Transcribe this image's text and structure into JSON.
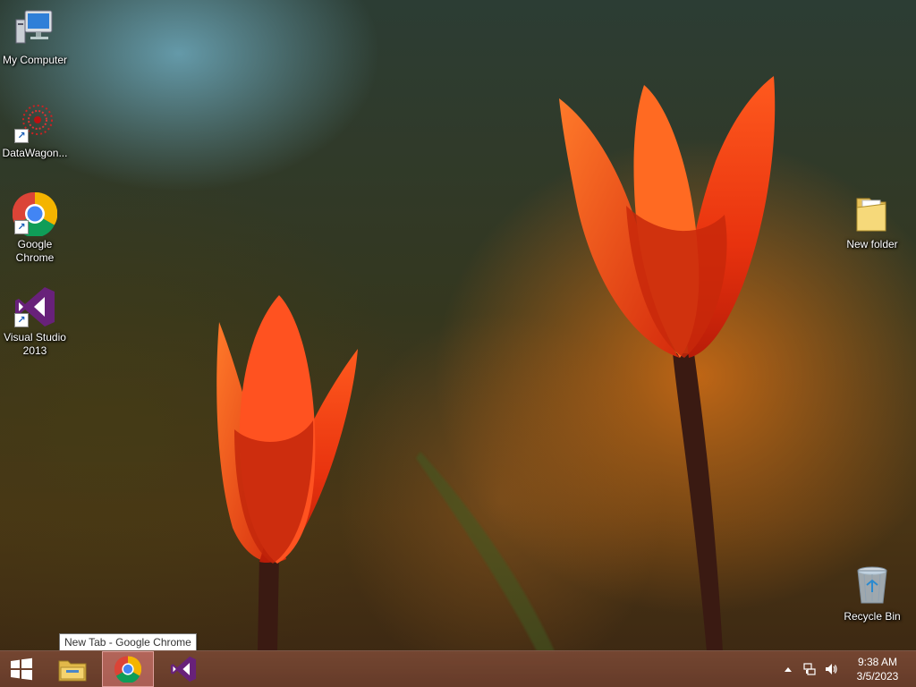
{
  "desktop": {
    "icons": [
      {
        "name": "my-computer",
        "label": "My Computer",
        "icon": "computer-icon"
      },
      {
        "name": "datawagon",
        "label": "DataWagon...",
        "icon": "datawagon-icon"
      },
      {
        "name": "google-chrome",
        "label": "Google\nChrome",
        "icon": "chrome-icon"
      },
      {
        "name": "visual-studio",
        "label": "Visual Studio\n2013",
        "icon": "visual-studio-icon"
      },
      {
        "name": "new-folder",
        "label": "New folder",
        "icon": "folder-icon"
      },
      {
        "name": "recycle-bin",
        "label": "Recycle Bin",
        "icon": "recycle-bin-icon"
      }
    ]
  },
  "taskbar": {
    "start_icon": "windows-logo-icon",
    "pinned": [
      {
        "name": "file-explorer",
        "icon": "folder-icon"
      },
      {
        "name": "chrome",
        "icon": "chrome-icon",
        "active": true
      },
      {
        "name": "visual-studio",
        "icon": "visual-studio-icon"
      }
    ],
    "tooltip": "New Tab - Google Chrome",
    "tray": {
      "icons": [
        "show-hidden-icons-icon",
        "network-icon",
        "volume-icon"
      ]
    },
    "clock": {
      "time": "9:38 AM",
      "date": "3/5/2023"
    }
  },
  "colors": {
    "taskbar": "#744632",
    "active_task": "#d98a86",
    "vs_purple": "#68217a"
  }
}
